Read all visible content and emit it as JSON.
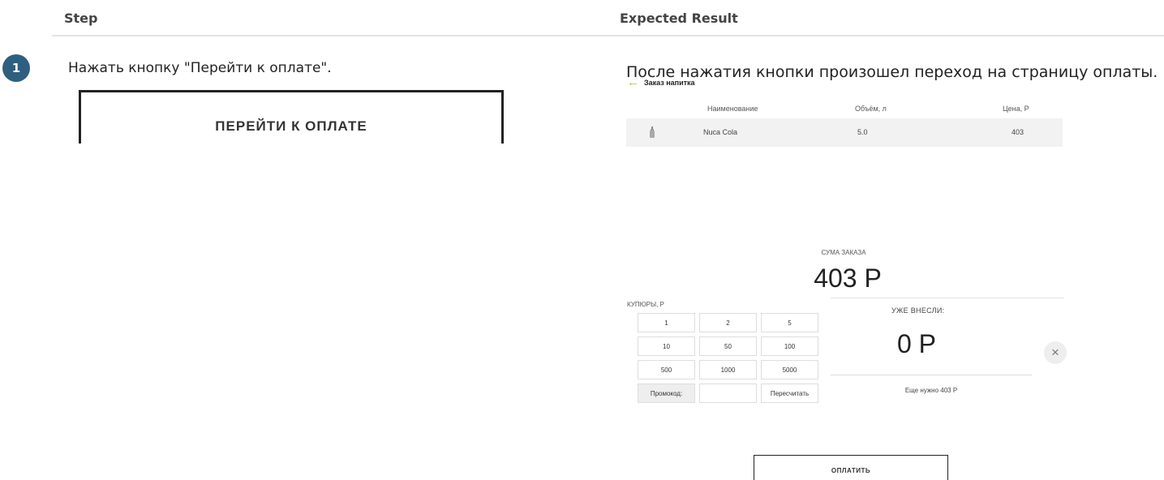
{
  "header": {
    "step": "Step",
    "expected": "Expected Result"
  },
  "step": {
    "number": "1",
    "text": "Нажать кнопку \"Перейти к оплате\".",
    "button_label": "ПЕРЕЙТИ К ОПЛАТЕ"
  },
  "result": {
    "text": "После нажатия кнопки произошел переход на страницу оплаты.",
    "back_label": "Заказ напитка",
    "table": {
      "headers": [
        "Наименование",
        "Объём, л",
        "Цена, Р"
      ],
      "row": {
        "name": "Nuca Cola",
        "volume": "5.0",
        "price": "403"
      }
    },
    "sum_label": "СУМА ЗАКАЗА",
    "sum_value": "403 Р",
    "bills_label": "КУПЮРЫ, Р",
    "bills": [
      "1",
      "2",
      "5",
      "10",
      "50",
      "100",
      "500",
      "1000",
      "5000"
    ],
    "promo_label": "Промокод:",
    "promo_value": "",
    "recalc_label": "Пересчитать",
    "paid_label": "УЖЕ ВНЕСЛИ:",
    "paid_value": "0 Р",
    "clear_icon": "×",
    "need_text": "Еще нужно 403 Р",
    "pay_label": "ОПЛАТИТЬ"
  },
  "colors": {
    "step_badge": "#2f5f7f",
    "back_arrow": "#9acd32"
  }
}
